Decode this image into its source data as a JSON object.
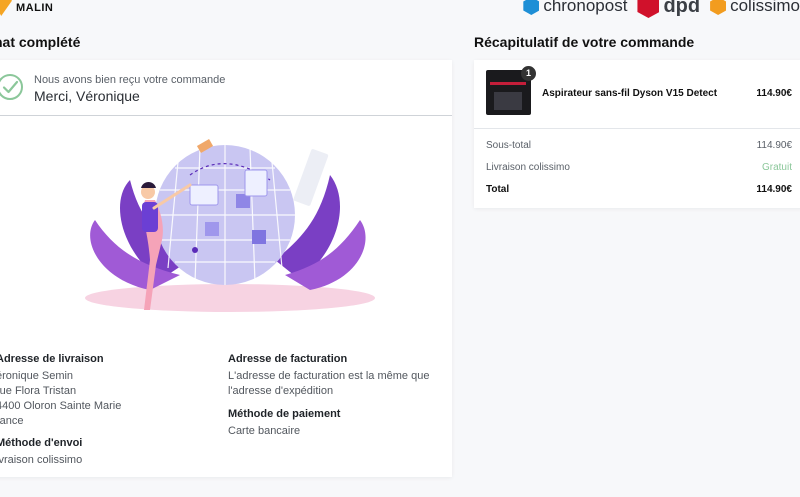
{
  "header": {
    "logo_text": "MALIN",
    "carriers": [
      "chronopost",
      "dpd",
      "colissimo"
    ]
  },
  "left": {
    "title": "hat complété",
    "confirm": {
      "subtitle": "Nous avons bien reçu votre commande",
      "thanks": "Merci, Véronique"
    },
    "shipping_address": {
      "title": "Adresse de livraison",
      "name": "éronique Semin",
      "line1": " rue Flora Tristan",
      "line2": "4400 Oloron Sainte Marie",
      "country": "rance"
    },
    "shipping_method": {
      "title": "Méthode d'envoi",
      "value": "ivraison colissimo"
    },
    "billing_address": {
      "title": "Adresse de facturation",
      "value": "L'adresse de facturation est la même que l'adresse d'expédition"
    },
    "payment_method": {
      "title": "Méthode de paiement",
      "value": "Carte bancaire"
    }
  },
  "right": {
    "title": "Récapitulatif de votre commande",
    "product": {
      "qty": "1",
      "name": "Aspirateur sans-fil Dyson V15 Detect",
      "price": "114.90€"
    },
    "summary": {
      "subtotal_label": "Sous-total",
      "subtotal_value": "114.90€",
      "shipping_label": "Livraison colissimo",
      "shipping_value": "Gratuit",
      "total_label": "Total",
      "total_value": "114.90€"
    }
  },
  "colors": {
    "accent_green": "#8bc79a",
    "illustration_purple": "#6b3fd4"
  }
}
